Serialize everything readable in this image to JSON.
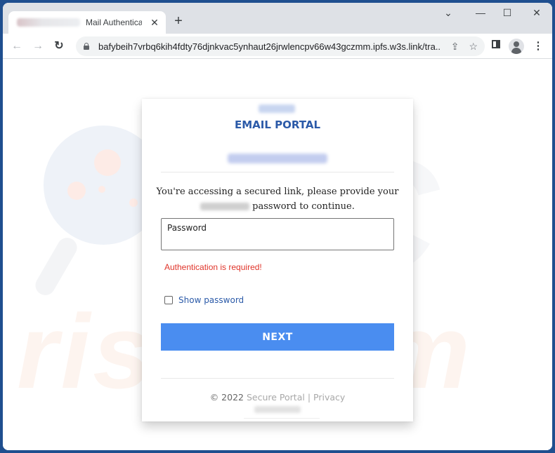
{
  "browser": {
    "tab": {
      "title": "Mail Authentication",
      "favicon_redacted": true
    },
    "new_tab_label": "+",
    "address_bar": {
      "url": "bafybeih7vrbq6kih4fdty76djnkvac5ynhaut26jrwlencpv66w43gczmm.ipfs.w3s.link/tra..."
    },
    "icons": {
      "back": "←",
      "forward": "→",
      "reload": "↻",
      "share": "⇪",
      "bookmark": "☆",
      "menu": "⋮",
      "tab_search": "⌄",
      "minimize": "—",
      "maximize": "☐",
      "close": "✕",
      "tab_close": "✕"
    }
  },
  "page": {
    "portal_title": "EMAIL PORTAL",
    "email_redacted": true,
    "notice_line1": "You're accessing a secured link, please provide your",
    "notice_line2": "password to continue.",
    "password_field": {
      "label": "Password",
      "value": ""
    },
    "error_message": "Authentication is required!",
    "show_password_label": "Show password",
    "show_password_checked": false,
    "next_button": "NEXT",
    "footer": {
      "copyright": "© 2022",
      "secure_portal": "Secure Portal",
      "separator": "|",
      "privacy": "Privacy"
    }
  },
  "watermark": {
    "text_top": "PC",
    "text_bottom": "risk.com"
  },
  "colors": {
    "accent_blue": "#2b5aa8",
    "button_blue": "#4a8df0",
    "error_red": "#e0352b",
    "frame_blue": "#1f4f8f"
  }
}
